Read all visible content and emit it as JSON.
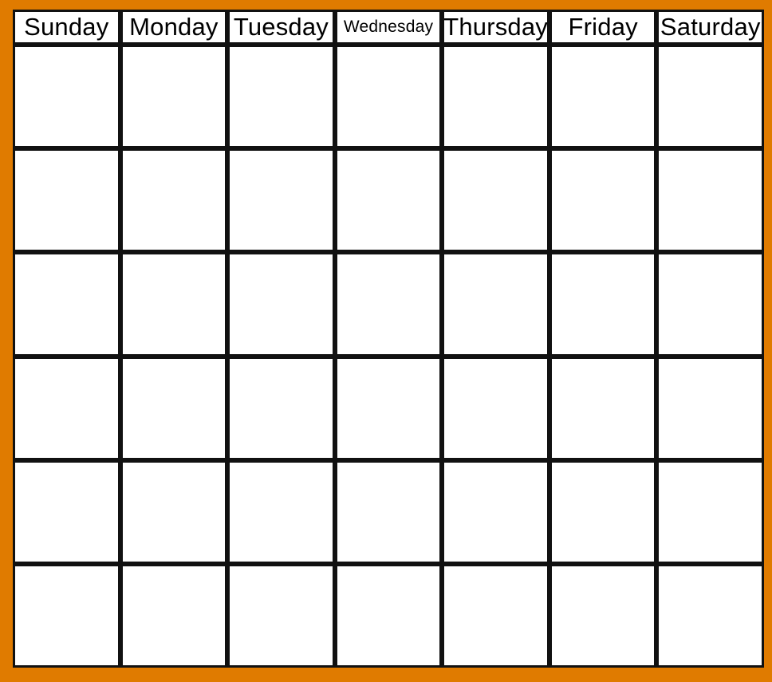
{
  "calendar": {
    "frame_color": "#E07B00",
    "grid_line_color": "#111111",
    "cell_background": "#ffffff",
    "day_headers": [
      {
        "label": "Sunday",
        "compact": false
      },
      {
        "label": "Monday",
        "compact": false
      },
      {
        "label": "Tuesday",
        "compact": false
      },
      {
        "label": "Wednesday",
        "compact": true
      },
      {
        "label": "Thursday",
        "compact": false
      },
      {
        "label": "Friday",
        "compact": false
      },
      {
        "label": "Saturday",
        "compact": false
      }
    ],
    "week_count": 6,
    "weeks": [
      {
        "days": [
          "",
          "",
          "",
          "",
          "",
          "",
          ""
        ]
      },
      {
        "days": [
          "",
          "",
          "",
          "",
          "",
          "",
          ""
        ]
      },
      {
        "days": [
          "",
          "",
          "",
          "",
          "",
          "",
          ""
        ]
      },
      {
        "days": [
          "",
          "",
          "",
          "",
          "",
          "",
          ""
        ]
      },
      {
        "days": [
          "",
          "",
          "",
          "",
          "",
          "",
          ""
        ]
      },
      {
        "days": [
          "",
          "",
          "",
          "",
          "",
          "",
          ""
        ]
      }
    ]
  }
}
